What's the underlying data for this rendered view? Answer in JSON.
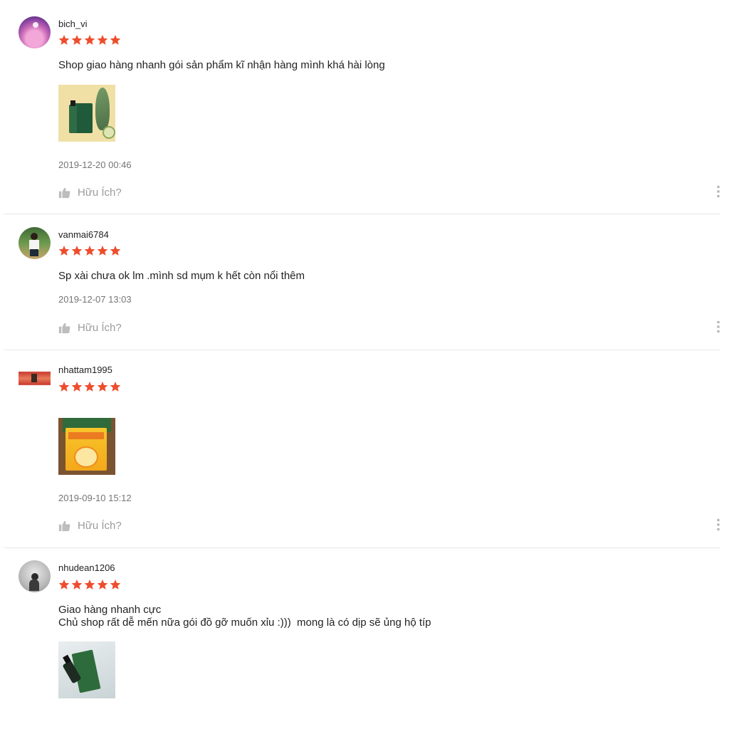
{
  "reviews": [
    {
      "username": "bich_vi",
      "rating": 5,
      "comment": "Shop giao hàng nhanh gói sản phẩm kĩ nhận hàng mình khá hài lòng",
      "timestamp": "2019-12-20 00:46",
      "helpful_label": "Hữu Ích?"
    },
    {
      "username": "vanmai6784",
      "rating": 5,
      "comment": "Sp xài chưa ok lm .mình sd mụm k hết còn nổi thêm",
      "timestamp": "2019-12-07 13:03",
      "helpful_label": "Hữu Ích?"
    },
    {
      "username": "nhattam1995",
      "rating": 5,
      "comment": "",
      "timestamp": "2019-09-10 15:12",
      "helpful_label": "Hữu Ích?"
    },
    {
      "username": "nhudean1206",
      "rating": 5,
      "comment_line1": "Giao hàng nhanh cực",
      "comment_line2": "Chủ shop rất dễ mến nữa gói đồ gỡ muốn xỉu :)))  mong là có dịp sẽ ủng hộ típ"
    }
  ],
  "colors": {
    "star": "#ee4d2d",
    "timestamp": "#757575",
    "helpful": "#9b9b9b",
    "divider": "#e8e8e8"
  },
  "icons": {
    "rating": "star-icon",
    "helpful": "thumbs-up-icon",
    "menu": "more-vertical-icon"
  }
}
